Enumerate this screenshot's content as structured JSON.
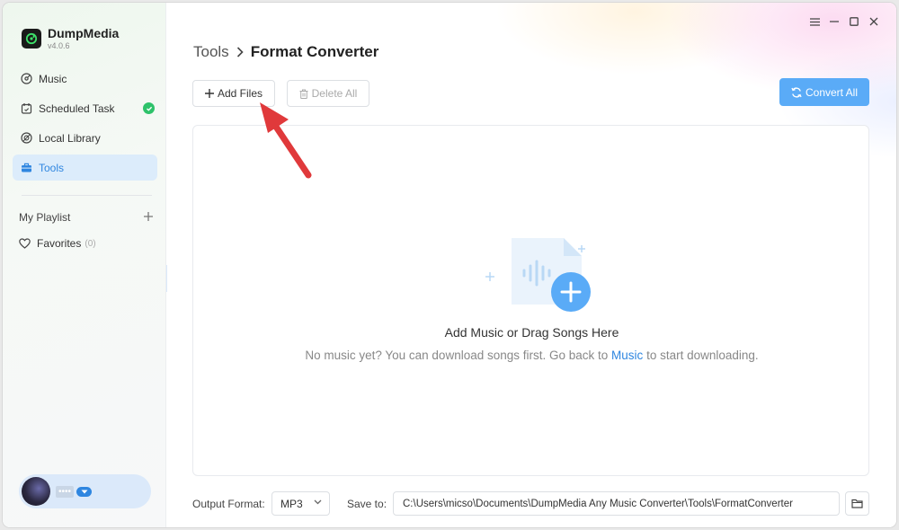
{
  "app": {
    "name": "DumpMedia",
    "version": "v4.0.6"
  },
  "sidebar": {
    "items": [
      {
        "label": "Music",
        "icon": "music-disc-icon"
      },
      {
        "label": "Scheduled Task",
        "icon": "calendar-icon"
      },
      {
        "label": "Local Library",
        "icon": "library-icon"
      },
      {
        "label": "Tools",
        "icon": "toolbox-icon",
        "active": true
      }
    ],
    "playlist_header": "My Playlist",
    "favorites_label": "Favorites",
    "favorites_count": "(0)",
    "user_name": "••••"
  },
  "breadcrumb": {
    "root": "Tools",
    "current": "Format Converter"
  },
  "toolbar": {
    "add_files": "Add Files",
    "delete_all": "Delete All",
    "convert_all": "Convert All"
  },
  "dropzone": {
    "title": "Add Music or Drag Songs Here",
    "subtitle_before": "No music yet? You can download songs first. Go back to ",
    "subtitle_link": "Music",
    "subtitle_after": " to start downloading."
  },
  "bottom": {
    "output_format_label": "Output Format:",
    "output_format_value": "MP3",
    "save_to_label": "Save to:",
    "save_path": "C:\\Users\\micso\\Documents\\DumpMedia Any Music Converter\\Tools\\FormatConverter"
  },
  "colors": {
    "accent": "#2f86e0",
    "convert_button": "#5aabf7",
    "active_nav_bg": "#dcecfb",
    "success": "#2ec26a",
    "annotation_arrow": "#e0393b"
  }
}
